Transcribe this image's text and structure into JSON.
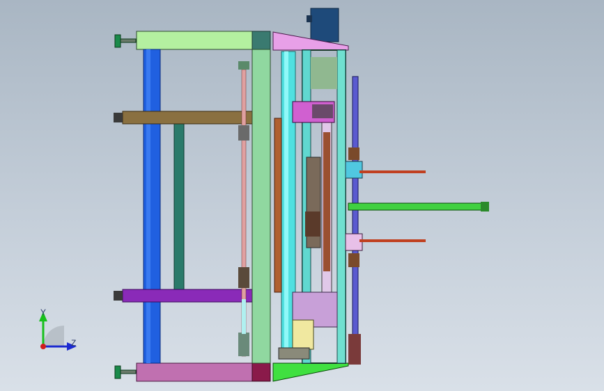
{
  "viewport": {
    "background_top": "#a9b6c3",
    "background_bottom": "#d9e0e8"
  },
  "triad": {
    "y_label": "Y",
    "z_label": "Z",
    "y_color": "#18c01c",
    "z_color": "#1c2ad0",
    "x_color": "#d01c1c"
  },
  "colors": {
    "frame_green": "#90d8a0",
    "top_rail": "#b4f0a0",
    "bottom_rail": "#c070b0",
    "left_post": "#2060e0",
    "cyan_shaft": "#50e0e0",
    "magenta_bar": "#8a2ab8",
    "pink_plate": "#e8a0e8",
    "brown_screw": "#b06030",
    "motor_blue": "#1e4a7a",
    "green_arm": "#40d040",
    "red_rod": "#c04020"
  }
}
